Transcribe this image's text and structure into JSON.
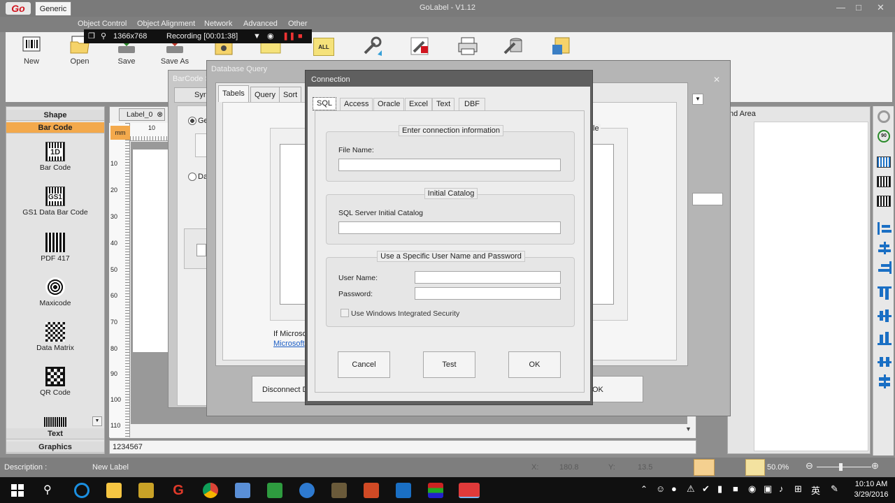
{
  "window": {
    "title": "GoLabel - V1.12",
    "logo": "Go"
  },
  "ribbon_tabs": [
    "Generic",
    "Object Control",
    "Object Alignment",
    "Network",
    "Advanced",
    "Other"
  ],
  "toolbar": {
    "new": "New",
    "open": "Open",
    "save": "Save",
    "save_as": "Save As",
    "all_icon_text": "ALL"
  },
  "recording": {
    "resolution": "1366x768",
    "status": "Recording [00:01:38]"
  },
  "left_panel": {
    "shape": "Shape",
    "bar_code": "Bar Code",
    "items": [
      "Bar Code",
      "GS1 Data Bar Code",
      "PDF 417",
      "Maxicode",
      "Data Matrix",
      "QR Code"
    ],
    "icon_1d": "1D",
    "icon_gs1": "GS1",
    "text": "Text",
    "graphics": "Graphics"
  },
  "work_area": {
    "label_tab": "Label_0",
    "unit": "mm",
    "ruler_top_first": "10",
    "ruler_left": [
      "10",
      "20",
      "30",
      "40",
      "50",
      "60",
      "70",
      "80",
      "90",
      "100",
      "110"
    ],
    "bottom_text": "1234567"
  },
  "barcode_dialog": {
    "title": "BarCode S",
    "tab": "Syr",
    "radio_1": "Ge",
    "radio_2": "Da"
  },
  "db_dialog": {
    "title": "Database Query",
    "tabs": [
      "Tabels",
      "Query",
      "Sort"
    ],
    "note_line1": "If Microso",
    "note_link": "Microsoft",
    "disconnect": "Disconnect D",
    "ok_partial": "OK",
    "field_partial": "le"
  },
  "right_panel": {
    "title": "nd Area"
  },
  "connection": {
    "title": "Connection",
    "tabs": [
      "SQL",
      "Access",
      "Oracle",
      "Excel",
      "Text",
      "DBF"
    ],
    "group1_title": "Enter connection information",
    "file_name_label": "File Name:",
    "file_name_value": "",
    "group2_title": "Initial Catalog",
    "catalog_label": "SQL Server Initial Catalog",
    "catalog_value": "",
    "group3_title": "Use a Specific User Name and Password",
    "user_label": "User Name:",
    "user_value": "",
    "password_label": "Password:",
    "password_value": "",
    "integrated": "Use Windows Integrated Security",
    "cancel": "Cancel",
    "test": "Test",
    "ok": "OK"
  },
  "status": {
    "description_label": "Description :",
    "description_value": "New Label",
    "x_label": "X:",
    "x_value": "180.8",
    "y_label": "Y:",
    "y_value": "13.5",
    "zoom": "50.0%"
  },
  "taskbar": {
    "time": "10:10 AM",
    "date": "3/29/2016",
    "ime": "英"
  },
  "colors": {
    "accent_orange": "#f3a94c",
    "brand_red": "#d0141e"
  }
}
